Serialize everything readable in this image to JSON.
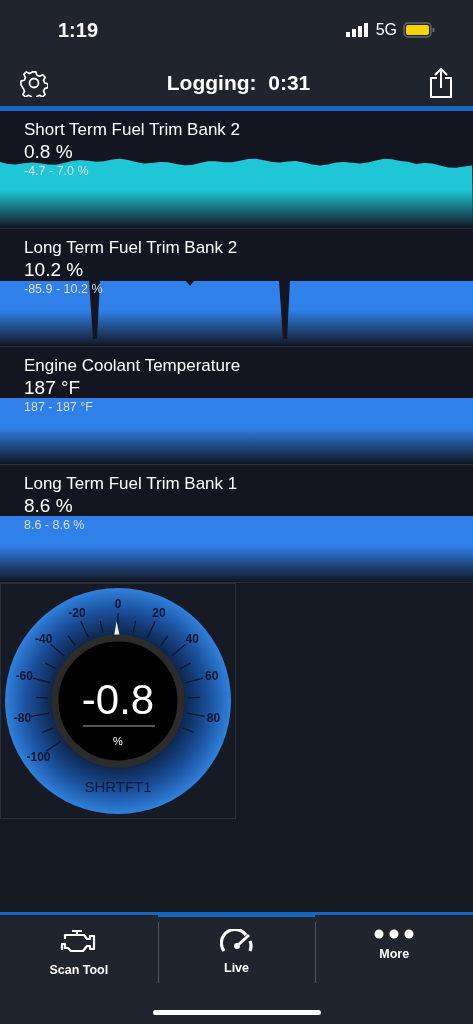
{
  "status_bar": {
    "time": "1:19",
    "network": "5G"
  },
  "header": {
    "title": "Logging:  0:31"
  },
  "pids": [
    {
      "name": "Short Term Fuel Trim Bank 2",
      "value": "0.8 %",
      "range": "-4.7 - 7.0 %",
      "color": "#1ec6d6",
      "kind": "wavy"
    },
    {
      "name": "Long Term Fuel Trim Bank 2",
      "value": "10.2 %",
      "range": "-85.9 - 10.2 %",
      "color": "#2f80e8",
      "kind": "spikes"
    },
    {
      "name": "Engine Coolant Temperature",
      "value": "187 °F",
      "range": "187 - 187 °F",
      "color": "#2f80e8",
      "kind": "flat"
    },
    {
      "name": "Long Term Fuel Trim Bank 1",
      "value": "8.6 %",
      "range": "8.6 - 8.6 %",
      "color": "#2f80e8",
      "kind": "flat"
    }
  ],
  "gauge": {
    "ticks": [
      "-100",
      "-80",
      "-60",
      "-40",
      "-20",
      "0",
      "20",
      "40",
      "60",
      "80"
    ],
    "value": "-0.8",
    "unit": "%",
    "name": "SHRTFT1"
  },
  "tabs": [
    {
      "label": "Scan Tool",
      "kind": "engine",
      "selected": false
    },
    {
      "label": "Live",
      "kind": "gauge",
      "selected": true
    },
    {
      "label": "More",
      "kind": "dots",
      "selected": false
    }
  ]
}
